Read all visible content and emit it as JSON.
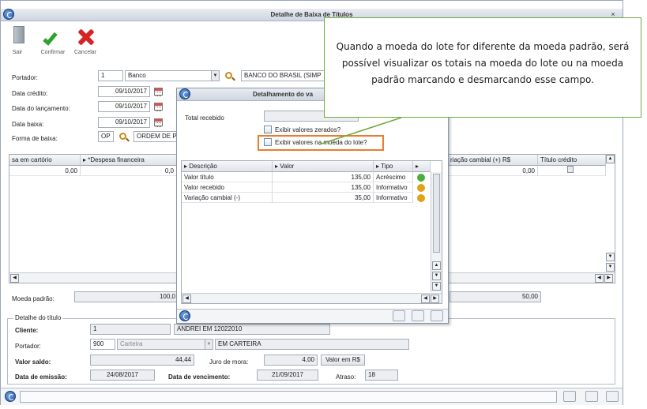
{
  "window": {
    "title": "Detalhe de Baixa de Títulos",
    "close_glyph": "×"
  },
  "toolbar": {
    "exit_label": "Sair",
    "confirm_label": "Confirmar",
    "cancel_label": "Cancelar"
  },
  "form": {
    "portador_label": "Portador:",
    "portador_code": "1",
    "portador_type": "Banco",
    "portador_name": "BANCO DO BRASIL (SIMP",
    "data_credito_label": "Data crédito:",
    "data_credito": "09/10/2017",
    "data_lancamento_label": "Data do lançamento:",
    "data_lancamento": "09/10/2017",
    "data_baixa_label": "Data baixa:",
    "data_baixa": "09/10/2017",
    "forma_baixa_label": "Forma de  baixa:",
    "forma_baixa_code": "OP",
    "forma_baixa_name": "ORDEM DE P"
  },
  "main_grid": {
    "headers": [
      "sa em cartório",
      "*Despesa financeira",
      "riação cambial (+) R$",
      "Título crédito"
    ],
    "row": [
      "0,00",
      "0,0",
      "0,00",
      ""
    ]
  },
  "moeda_padrao": {
    "label": "Moeda padrão:",
    "value": "100,0",
    "right_value": "50,00"
  },
  "detalhe": {
    "legend": "Detalhe do título",
    "cliente_label": "Cliente:",
    "cliente_code": "1",
    "cliente_name": "ANDREI EM 12022010",
    "portador_label": "Portador:",
    "portador_code": "900",
    "portador_type": "Carteira",
    "portador_name": "EM CARTEIRA",
    "valor_saldo_label": "Valor saldo:",
    "valor_saldo": "44,44",
    "juro_label": "Juro de mora:",
    "juro": "4,00",
    "valor_rs_button": "Valor em R$",
    "data_emissao_label": "Data de emissão:",
    "data_emissao": "24/08/2017",
    "data_vencimento_label": "Data de vencimento:",
    "data_vencimento": "21/09/2017",
    "atraso_label": "Atraso:",
    "atraso": "18"
  },
  "modal": {
    "title": "Detalhamento do va",
    "total_label": "Total recebido",
    "cb_zerados": "Exibir valores zerados?",
    "cb_moeda_lote": "Exibir valores na moeda do lote?",
    "headers": [
      "Descrição",
      "Valor",
      "Tipo"
    ],
    "rows": [
      {
        "descricao": "Valor título",
        "valor": "135,00",
        "tipo": "Acréscimo",
        "status_color": "#4caf3a"
      },
      {
        "descricao": "Valor recebido",
        "valor": "135,00",
        "tipo": "Informativo",
        "status_color": "#e0a21b"
      },
      {
        "descricao": "Variação cambial (-)",
        "valor": "35,00",
        "tipo": "Informativo",
        "status_color": "#e0a21b"
      }
    ]
  },
  "callout": {
    "text": "Quando a moeda do lote for diferente da moeda padrão, será possível visualizar os totais na moeda do lote ou na moeda padrão marcando e desmarcando esse campo."
  },
  "colors": {
    "callout_border": "#6eaa3c",
    "highlight": "#ee7b2a"
  }
}
